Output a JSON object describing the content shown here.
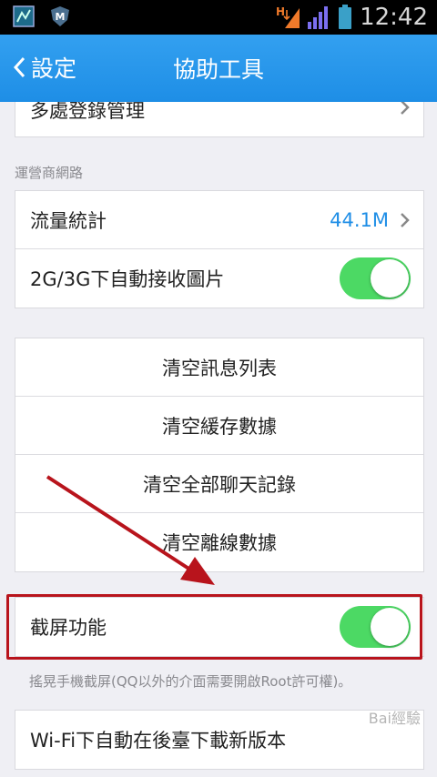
{
  "status_bar": {
    "time": "12:42",
    "network_label": "H"
  },
  "nav": {
    "back_label": "設定",
    "title": "協助工具"
  },
  "top_partial_row": {
    "label": "多處登錄管理"
  },
  "carrier_section": {
    "header": "運營商網路",
    "rows": [
      {
        "label": "流量統計",
        "value": "44.1M"
      },
      {
        "label": "2G/3G下自動接收圖片",
        "toggle_on": true
      }
    ]
  },
  "clear_section": {
    "rows": [
      {
        "label": "清空訊息列表"
      },
      {
        "label": "清空緩存數據"
      },
      {
        "label": "清空全部聊天記錄"
      },
      {
        "label": "清空離線數據"
      }
    ]
  },
  "screenshot_section": {
    "row": {
      "label": "截屏功能",
      "toggle_on": true
    },
    "footnote": "搖晃手機截屏(QQ以外的介面需要開啟Root許可權)。"
  },
  "update_section": {
    "row": {
      "label": "Wi-Fi下自動在後臺下載新版本"
    }
  },
  "watermark": "Bai經驗",
  "colors": {
    "nav_bg": "#2196ec",
    "accent": "#1f8ee6",
    "toggle_on": "#4cd964",
    "annotation": "#b8141c"
  }
}
